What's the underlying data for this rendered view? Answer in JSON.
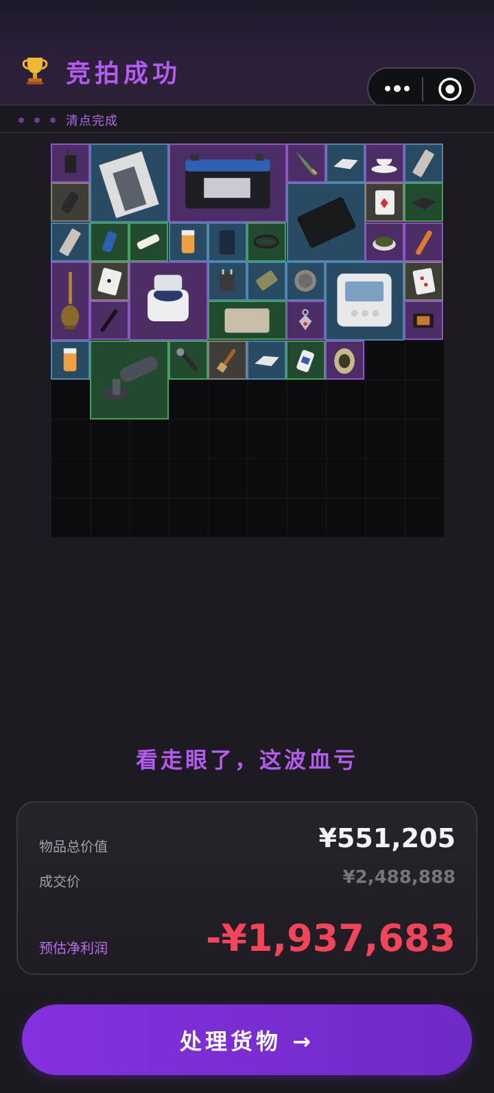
{
  "header": {
    "title": "竞拍成功",
    "trophy_icon": "trophy-icon"
  },
  "capsule": {
    "more_icon": "more-dots-icon",
    "close_icon": "target-circle-icon"
  },
  "progress": {
    "label": "清点完成",
    "dot_count": 3
  },
  "inventory": {
    "rarity_colors": {
      "blue": "#4f86ad",
      "purple": "#8d55c1",
      "green": "#45a15c",
      "gray": "#86817a"
    },
    "items": [
      {
        "name": "walkie-talkie",
        "rarity": "purple"
      },
      {
        "name": "fashion-magazine",
        "rarity": "blue"
      },
      {
        "name": "car-battery",
        "rarity": "purple"
      },
      {
        "name": "jade-dagger",
        "rarity": "purple"
      },
      {
        "name": "silver-ingot",
        "rarity": "blue"
      },
      {
        "name": "teacup",
        "rarity": "purple"
      },
      {
        "name": "circuit-board",
        "rarity": "blue"
      },
      {
        "name": "hair-clippers",
        "rarity": "gray"
      },
      {
        "name": "tablet",
        "rarity": "blue"
      },
      {
        "name": "playing-card",
        "rarity": "gray"
      },
      {
        "name": "hard-drive",
        "rarity": "green"
      },
      {
        "name": "memory-stick",
        "rarity": "blue"
      },
      {
        "name": "energy-drink",
        "rarity": "green"
      },
      {
        "name": "battery-cell",
        "rarity": "green"
      },
      {
        "name": "pill-bottle",
        "rarity": "blue"
      },
      {
        "name": "coffee-bag",
        "rarity": "blue"
      },
      {
        "name": "cable-coil",
        "rarity": "green"
      },
      {
        "name": "tea-leaves",
        "rarity": "purple"
      },
      {
        "name": "marker-pen",
        "rarity": "purple"
      },
      {
        "name": "hookah",
        "rarity": "purple"
      },
      {
        "name": "playing-card-spades",
        "rarity": "gray"
      },
      {
        "name": "centrifuge",
        "rarity": "purple"
      },
      {
        "name": "power-adapter",
        "rarity": "blue"
      },
      {
        "name": "cash-bundle",
        "rarity": "blue"
      },
      {
        "name": "ancient-coin",
        "rarity": "blue"
      },
      {
        "name": "thermometer-display",
        "rarity": "blue"
      },
      {
        "name": "playing-card-hearts",
        "rarity": "gray"
      },
      {
        "name": "fountain-pen",
        "rarity": "purple"
      },
      {
        "name": "old-map",
        "rarity": "green"
      },
      {
        "name": "earring",
        "rarity": "purple"
      },
      {
        "name": "cpu-chip",
        "rarity": "purple"
      },
      {
        "name": "pill-bottle-2",
        "rarity": "blue"
      },
      {
        "name": "angle-grinder",
        "rarity": "green"
      },
      {
        "name": "wrench",
        "rarity": "green"
      },
      {
        "name": "paint-brush",
        "rarity": "gray"
      },
      {
        "name": "silver-ingot-2",
        "rarity": "blue"
      },
      {
        "name": "medicine-bottle",
        "rarity": "green"
      },
      {
        "name": "fossil-egg",
        "rarity": "purple"
      }
    ]
  },
  "verdict": "看走眼了，这波血亏",
  "summary": {
    "total_label": "物品总价值",
    "total_value": "¥551,205",
    "deal_label": "成交价",
    "deal_value": "¥2,488,888",
    "profit_label": "预估净利润",
    "profit_value": "-¥1,937,683",
    "profit_color": "#f2455c"
  },
  "action": {
    "label": "处理货物 →"
  }
}
